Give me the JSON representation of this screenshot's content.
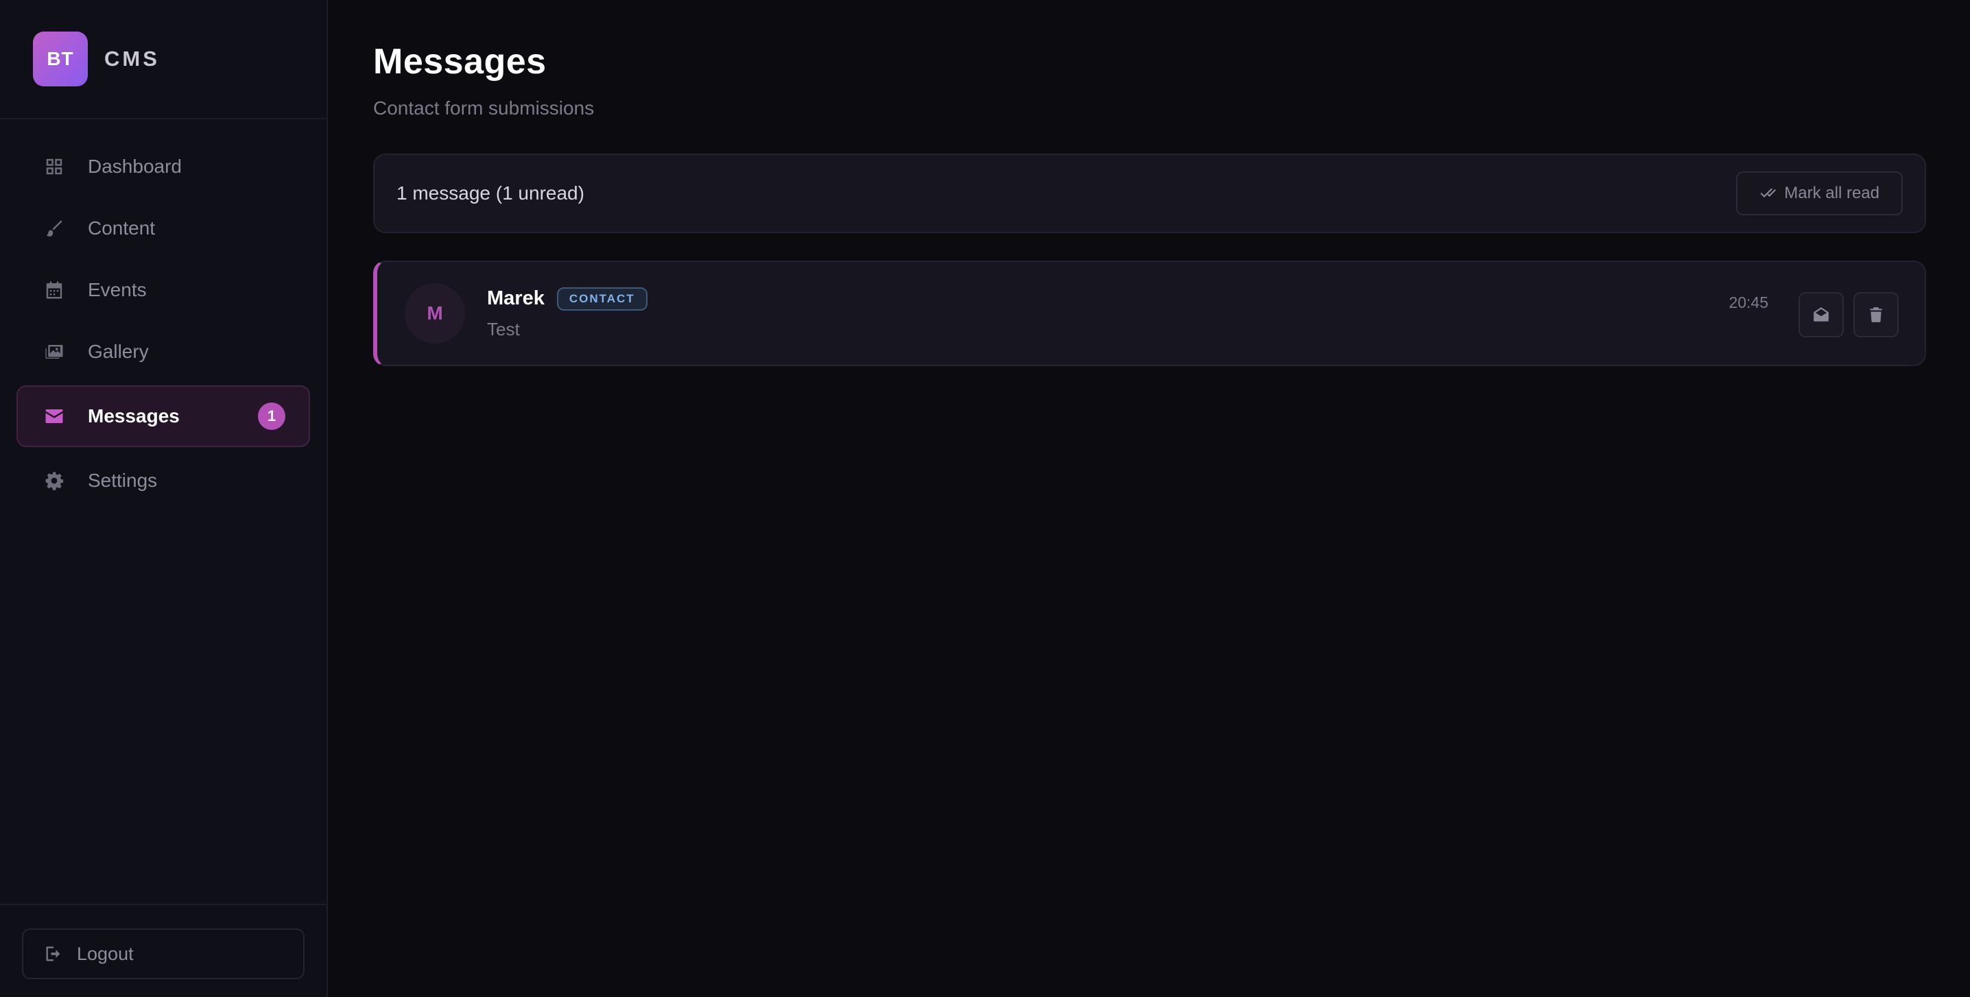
{
  "brand": {
    "logo_text": "BT",
    "name": "CMS"
  },
  "sidebar": {
    "items": [
      {
        "label": "Dashboard",
        "icon": "dashboard-icon"
      },
      {
        "label": "Content",
        "icon": "brush-icon"
      },
      {
        "label": "Events",
        "icon": "calendar-icon"
      },
      {
        "label": "Gallery",
        "icon": "images-icon"
      },
      {
        "label": "Messages",
        "icon": "envelope-icon",
        "badge": "1",
        "active": true
      },
      {
        "label": "Settings",
        "icon": "gear-icon"
      }
    ],
    "logout_label": "Logout"
  },
  "main": {
    "title": "Messages",
    "subtitle": "Contact form submissions",
    "toolbar": {
      "count_text": "1 message (1 unread)",
      "mark_all_read_label": "Mark all read"
    },
    "messages": [
      {
        "avatar_initial": "M",
        "sender": "Marek",
        "tag": "CONTACT",
        "preview": "Test",
        "time": "20:45",
        "unread": true
      }
    ]
  },
  "colors": {
    "background": "#0b0b10",
    "sidebar": "#0f0f17",
    "accent": "#b550b8",
    "tag_blue": "#7fb3ea"
  }
}
